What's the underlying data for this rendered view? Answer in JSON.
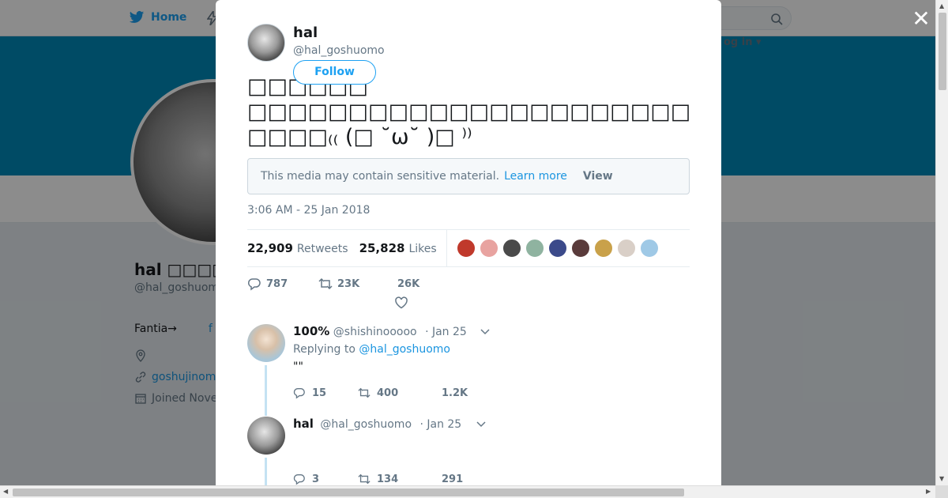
{
  "nav": {
    "home_label": "Home",
    "login_label": "og in ▾"
  },
  "profile": {
    "name": "hal □□□□□",
    "handle": "@hal_goshuom",
    "bio_left": "Fantia→",
    "bio_link": "f",
    "website": "goshujinom",
    "joined": "Joined Nove"
  },
  "tweet": {
    "author_name": "hal",
    "author_handle": "@hal_goshuomo",
    "follow_label": "Follow",
    "text_lines": [
      "□□□□□□",
      "□□□□□□□□□□□□□□□□□□□□□□□□□□□□□□□□□□□□□□",
      "□□□□₍₍ (□ ˘ω˘ )□ ⁾⁾"
    ],
    "sensitive_text": "This media may contain sensitive material.",
    "learn_more": "Learn more",
    "view_label": "View",
    "timestamp": "3:06 AM - 25 Jan 2018",
    "retweets_count": "22,909",
    "retweets_label": "Retweets",
    "likes_count": "25,828",
    "likes_label": "Likes",
    "liker_colors": [
      "#c0392b",
      "#e8a3a0",
      "#4a4a4a",
      "#8fb3a0",
      "#3b4a8a",
      "#5a3b3b",
      "#c9a14a",
      "#d9cfc7",
      "#9fc9e6"
    ],
    "reply_count": "787",
    "retweet_short": "23K",
    "like_short": "26K"
  },
  "replies": [
    {
      "name": "100%",
      "handle": "@shishinooooo",
      "date": "· Jan 25",
      "replying_prefix": "Replying to",
      "replying_to": "@hal_goshuomo",
      "body": "\"\"",
      "reply_count": "15",
      "retweet_count": "400",
      "like_count": "1.2K",
      "avatar_color": "#a9c6d8"
    },
    {
      "name": "hal",
      "handle": "@hal_goshuomo",
      "date": "· Jan 25",
      "reply_count": "3",
      "retweet_count": "134",
      "like_count": "291",
      "avatar_color": "#7a7a7a"
    }
  ]
}
